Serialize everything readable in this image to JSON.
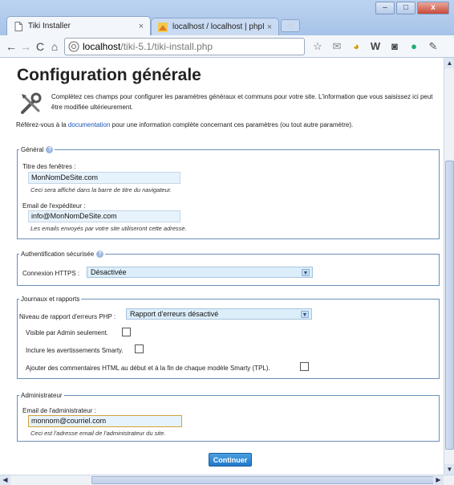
{
  "browser": {
    "tabs": [
      {
        "label": "Tiki Installer",
        "close": "×"
      },
      {
        "label": "localhost / localhost | phpM...",
        "close": "×"
      }
    ],
    "new_tab": "+",
    "window_buttons": {
      "minimize": "–",
      "maximize": "□",
      "close": "x"
    },
    "address": {
      "host": "localhost",
      "path": "/tiki-5.1/tiki-install.php"
    },
    "extension_icons": [
      "star-icon",
      "gmail-icon",
      "pie-icon",
      "w-icon",
      "camera-icon",
      "color-wheel-icon",
      "wrench-icon"
    ]
  },
  "page": {
    "title": "Configuration générale",
    "intro": "Complétez ces champs pour configurer les paramètres généraux et communs pour votre site. L'information que vous saisissez ici peut être modifiée ultérieurement.",
    "ref_prefix": "Référez-vous à la ",
    "ref_link": "documentation",
    "ref_suffix": " pour une information complète concernant ces paramètres (ou tout autre paramètre).",
    "general": {
      "legend": "Général",
      "browser_title_label": "Titre des fenêtres :",
      "browser_title_value": "MonNomDeSite.com",
      "browser_title_hint": "Ceci sera affiché dans la barre de titre du navigateur.",
      "sender_email_label": "Email de l'expéditeur :",
      "sender_email_value": "info@MonNomDeSite.com",
      "sender_email_hint": "Les emails envoyés par votre site utiliseront cette adresse."
    },
    "secure_login": {
      "legend": "Authentification sécurisée",
      "https_label": "Connexion HTTPS :",
      "https_value": "Désactivée"
    },
    "logging": {
      "legend": "Journaux et rapports",
      "error_level_label": "Niveau de rapport d'erreurs PHP :",
      "error_level_value": "Rapport d'erreurs désactivé",
      "admin_only_label": "Visible par Admin seulement.",
      "smarty_notice_label": "Inclure les avertissements Smarty.",
      "html_comments_label": "Ajouter des commentaires HTML au début et à la fin de chaque modèle Smarty (TPL)."
    },
    "admin": {
      "legend": "Administrateur",
      "email_label": "Email de l'administrateur :",
      "email_value": "monnom@courriel.com",
      "email_hint": "Ceci est l'adresse email de l'administrateur du site."
    },
    "continue_button": "Continuer"
  }
}
